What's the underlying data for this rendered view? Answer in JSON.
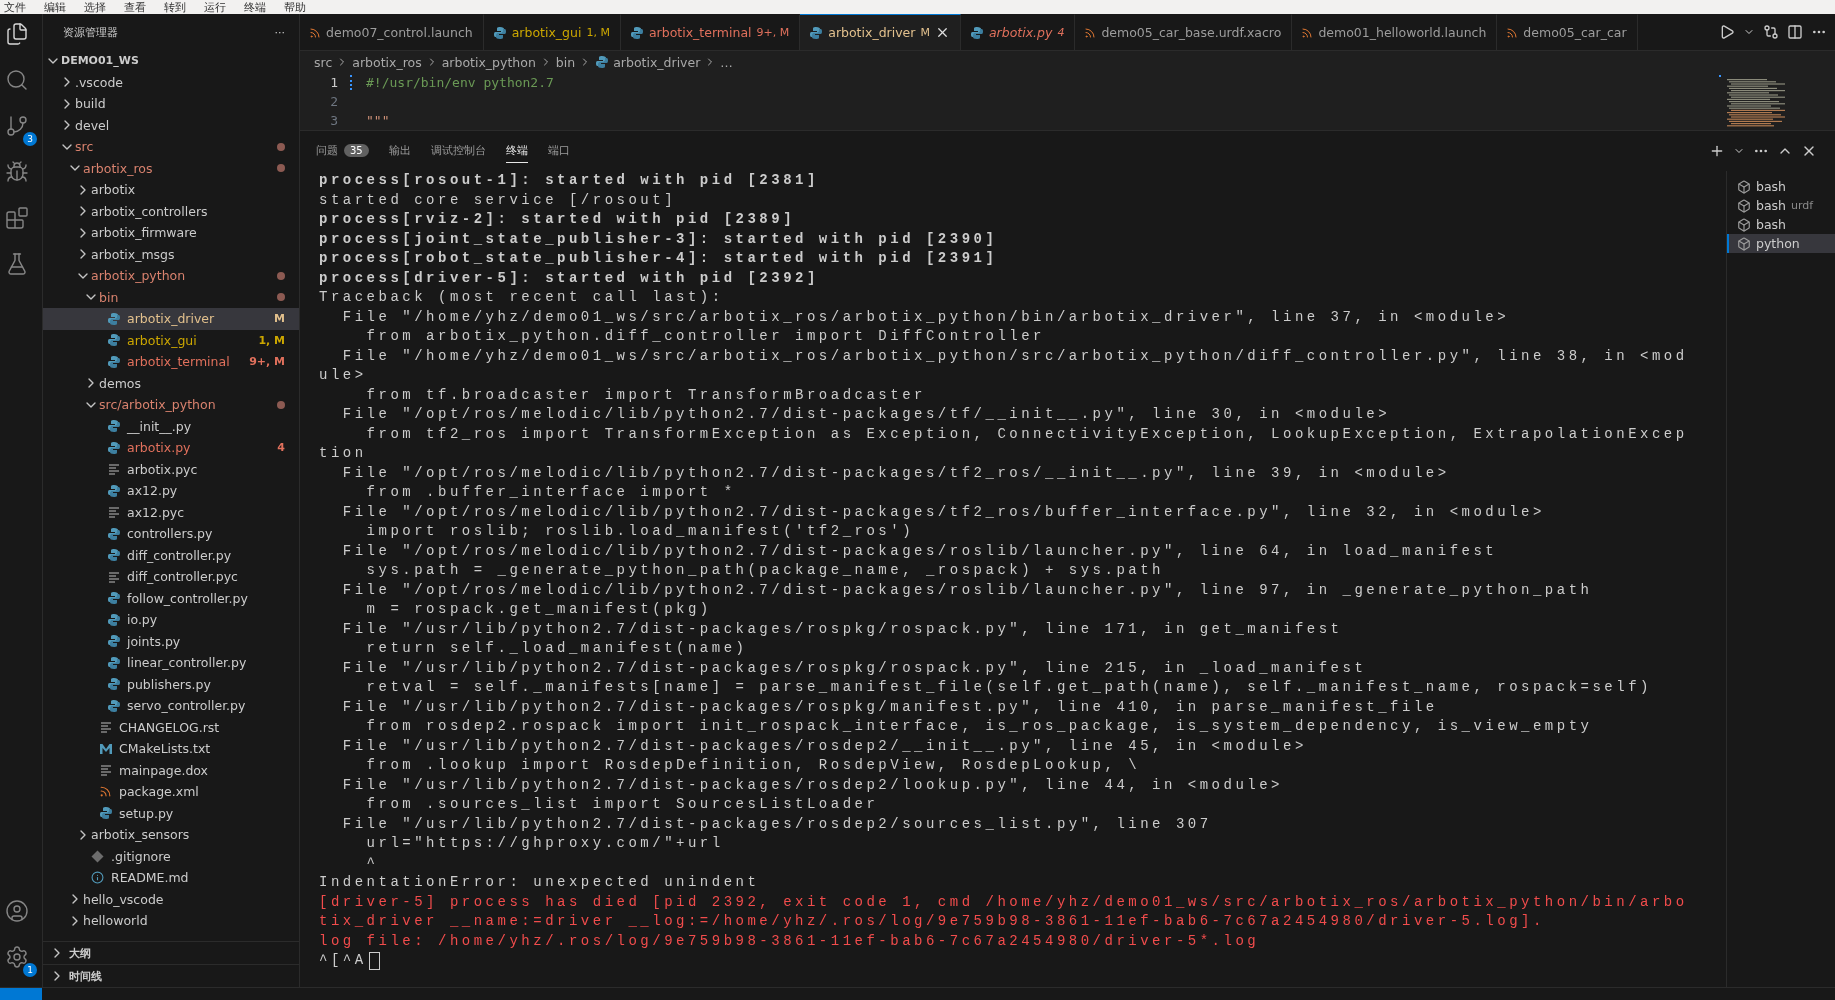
{
  "menu": [
    "文件",
    "编辑",
    "选择",
    "查看",
    "转到",
    "运行",
    "终端",
    "帮助"
  ],
  "activity_bar": {
    "top": [
      {
        "selected": true
      },
      {
        "selected": false
      },
      {
        "selected": false,
        "badge": "3"
      },
      {
        "selected": false
      },
      {
        "selected": false
      },
      {
        "selected": false
      }
    ],
    "bottom": [
      {
        "selected": false
      },
      {
        "selected": false,
        "badge": "1"
      }
    ]
  },
  "sidebar": {
    "title": "资源管理器",
    "more": "···",
    "workspace": {
      "label": "DEMO01_WS",
      "expanded": true
    },
    "tree": [
      {
        "label": ".vscode",
        "kind": "folder",
        "expanded": false,
        "modified": false,
        "selected": false
      },
      {
        "label": "build",
        "kind": "folder",
        "expanded": false,
        "modified": false,
        "selected": false
      },
      {
        "label": "devel",
        "kind": "folder",
        "expanded": false,
        "modified": false,
        "selected": false
      },
      {
        "label": "src",
        "kind": "folder",
        "expanded": true,
        "modified": true,
        "selected": false,
        "color": "#d9826e",
        "children": [
          {
            "label": "arbotix_ros",
            "kind": "folder",
            "expanded": true,
            "modified": true,
            "selected": false,
            "color": "#d9826e",
            "children": [
              {
                "label": "arbotix",
                "kind": "folder",
                "expanded": false,
                "modified": false,
                "selected": false
              },
              {
                "label": "arbotix_controllers",
                "kind": "folder",
                "expanded": false,
                "modified": false,
                "selected": false
              },
              {
                "label": "arbotix_firmware",
                "kind": "folder",
                "expanded": false,
                "modified": false,
                "selected": false
              },
              {
                "label": "arbotix_msgs",
                "kind": "folder",
                "expanded": false,
                "modified": false,
                "selected": false
              },
              {
                "label": "arbotix_python",
                "kind": "folder",
                "expanded": true,
                "modified": true,
                "selected": false,
                "color": "#d9826e",
                "children": [
                  {
                    "label": "bin",
                    "kind": "folder",
                    "expanded": true,
                    "modified": true,
                    "selected": false,
                    "color": "#d9826e",
                    "children": [
                      {
                        "label": "arbotix_driver",
                        "kind": "python",
                        "selected": true,
                        "color": "#e2c08d",
                        "badge": "M"
                      },
                      {
                        "label": "arbotix_gui",
                        "kind": "python",
                        "selected": false,
                        "color": "#cca700",
                        "badge": "1, M"
                      },
                      {
                        "label": "arbotix_terminal",
                        "kind": "python",
                        "selected": false,
                        "color": "#e0705c",
                        "badge": "9+, M"
                      }
                    ]
                  },
                  {
                    "label": "demos",
                    "kind": "folder",
                    "expanded": false,
                    "modified": false,
                    "selected": false
                  },
                  {
                    "label": "src/arbotix_python",
                    "kind": "folder",
                    "expanded": true,
                    "modified": true,
                    "selected": false,
                    "color": "#d9826e",
                    "children": [
                      {
                        "label": "__init__.py",
                        "kind": "python",
                        "selected": false
                      },
                      {
                        "label": "arbotix.py",
                        "kind": "python",
                        "selected": false,
                        "color": "#e0705c",
                        "badge": "4"
                      },
                      {
                        "label": "arbotix.pyc",
                        "kind": "text",
                        "selected": false
                      },
                      {
                        "label": "ax12.py",
                        "kind": "python",
                        "selected": false
                      },
                      {
                        "label": "ax12.pyc",
                        "kind": "text",
                        "selected": false
                      },
                      {
                        "label": "controllers.py",
                        "kind": "python",
                        "selected": false
                      },
                      {
                        "label": "diff_controller.py",
                        "kind": "python",
                        "selected": false
                      },
                      {
                        "label": "diff_controller.pyc",
                        "kind": "text",
                        "selected": false
                      },
                      {
                        "label": "follow_controller.py",
                        "kind": "python",
                        "selected": false
                      },
                      {
                        "label": "io.py",
                        "kind": "python",
                        "selected": false
                      },
                      {
                        "label": "joints.py",
                        "kind": "python",
                        "selected": false
                      },
                      {
                        "label": "linear_controller.py",
                        "kind": "python",
                        "selected": false
                      },
                      {
                        "label": "publishers.py",
                        "kind": "python",
                        "selected": false
                      },
                      {
                        "label": "servo_controller.py",
                        "kind": "python",
                        "selected": false
                      }
                    ]
                  },
                  {
                    "label": "CHANGELOG.rst",
                    "kind": "text",
                    "selected": false
                  },
                  {
                    "label": "CMakeLists.txt",
                    "kind": "cmake",
                    "selected": false
                  },
                  {
                    "label": "mainpage.dox",
                    "kind": "text",
                    "selected": false
                  },
                  {
                    "label": "package.xml",
                    "kind": "xml",
                    "selected": false
                  },
                  {
                    "label": "setup.py",
                    "kind": "python",
                    "selected": false
                  }
                ]
              },
              {
                "label": "arbotix_sensors",
                "kind": "folder",
                "expanded": false,
                "modified": false,
                "selected": false
              },
              {
                "label": ".gitignore",
                "kind": "git",
                "selected": false
              },
              {
                "label": "README.md",
                "kind": "info",
                "selected": false
              }
            ]
          },
          {
            "label": "hello_vscode",
            "kind": "folder",
            "expanded": false,
            "modified": false,
            "selected": false
          },
          {
            "label": "helloworld",
            "kind": "folder",
            "expanded": false,
            "modified": false,
            "selected": false
          }
        ]
      }
    ],
    "sections": [
      {
        "label": "大纲",
        "expanded": false
      },
      {
        "label": "时间线",
        "expanded": false
      }
    ]
  },
  "tabs": [
    {
      "label": "demo07_control.launch",
      "kind": "xml",
      "selected": false,
      "italic": false
    },
    {
      "label": "arbotix_gui",
      "kind": "python",
      "badge": "1, M",
      "color": "#cca700",
      "selected": false,
      "italic": false
    },
    {
      "label": "arbotix_terminal",
      "kind": "python",
      "badge": "9+, M",
      "color": "#e0705c",
      "selected": false,
      "italic": false
    },
    {
      "label": "arbotix_driver",
      "kind": "python",
      "badge": "M",
      "color": "#e2c08d",
      "selected": true,
      "italic": false
    },
    {
      "label": "arbotix.py",
      "kind": "python",
      "badge": "4",
      "color": "#e0705c",
      "selected": false,
      "italic": true
    },
    {
      "label": "demo05_car_base.urdf.xacro",
      "kind": "xml",
      "selected": false,
      "italic": false
    },
    {
      "label": "demo01_helloworld.launch",
      "kind": "xml",
      "selected": false,
      "italic": false
    },
    {
      "label": "demo05_car_car",
      "kind": "xml",
      "selected": false,
      "italic": false
    }
  ],
  "breadcrumb": [
    "src",
    "arbotix_ros",
    "arbotix_python",
    "bin",
    "arbotix_driver",
    "…"
  ],
  "editor": {
    "lines": [
      {
        "number": "1",
        "text": "#!/usr/bin/env python2.7",
        "kind": "comment"
      },
      {
        "number": "2",
        "kind": "blank"
      },
      {
        "number": "3",
        "text": "\"\"\"",
        "kind": "string"
      }
    ]
  },
  "panel": {
    "tabs": [
      {
        "label": "问题",
        "badge": "35",
        "selected": false
      },
      {
        "label": "输出",
        "selected": false
      },
      {
        "label": "调试控制台",
        "selected": false
      },
      {
        "label": "终端",
        "selected": true
      },
      {
        "label": "端口",
        "selected": false
      }
    ],
    "terminal_lines": [
      {
        "text": "process[rosout-1]: started with pid [2381]",
        "kind": "bold"
      },
      {
        "text": "started core service [/rosout]",
        "kind": "plain"
      },
      {
        "text": "process[rviz-2]: started with pid [2389]",
        "kind": "bold"
      },
      {
        "text": "process[joint_state_publisher-3]: started with pid [2390]",
        "kind": "bold"
      },
      {
        "text": "process[robot_state_publisher-4]: started with pid [2391]",
        "kind": "bold"
      },
      {
        "text": "process[driver-5]: started with pid [2392]",
        "kind": "bold"
      },
      {
        "text": "Traceback (most recent call last):",
        "kind": "plain"
      },
      {
        "text": "  File \"/home/yhz/demo01_ws/src/arbotix_ros/arbotix_python/bin/arbotix_driver\", line 37, in <module>",
        "kind": "plain"
      },
      {
        "text": "    from arbotix_python.diff_controller import DiffController",
        "kind": "plain"
      },
      {
        "text": "  File \"/home/yhz/demo01_ws/src/arbotix_ros/arbotix_python/src/arbotix_python/diff_controller.py\", line 38, in <mod",
        "kind": "plain"
      },
      {
        "text": "ule>",
        "kind": "plain"
      },
      {
        "text": "    from tf.broadcaster import TransformBroadcaster",
        "kind": "plain"
      },
      {
        "text": "  File \"/opt/ros/melodic/lib/python2.7/dist-packages/tf/__init__.py\", line 30, in <module>",
        "kind": "plain"
      },
      {
        "text": "    from tf2_ros import TransformException as Exception, ConnectivityException, LookupException, ExtrapolationExcep",
        "kind": "plain"
      },
      {
        "text": "tion",
        "kind": "plain"
      },
      {
        "text": "  File \"/opt/ros/melodic/lib/python2.7/dist-packages/tf2_ros/__init__.py\", line 39, in <module>",
        "kind": "plain"
      },
      {
        "text": "    from .buffer_interface import *",
        "kind": "plain"
      },
      {
        "text": "  File \"/opt/ros/melodic/lib/python2.7/dist-packages/tf2_ros/buffer_interface.py\", line 32, in <module>",
        "kind": "plain"
      },
      {
        "text": "    import roslib; roslib.load_manifest('tf2_ros')",
        "kind": "plain"
      },
      {
        "text": "  File \"/opt/ros/melodic/lib/python2.7/dist-packages/roslib/launcher.py\", line 64, in load_manifest",
        "kind": "plain"
      },
      {
        "text": "    sys.path = _generate_python_path(package_name, _rospack) + sys.path",
        "kind": "plain"
      },
      {
        "text": "  File \"/opt/ros/melodic/lib/python2.7/dist-packages/roslib/launcher.py\", line 97, in _generate_python_path",
        "kind": "plain"
      },
      {
        "text": "    m = rospack.get_manifest(pkg)",
        "kind": "plain"
      },
      {
        "text": "  File \"/usr/lib/python2.7/dist-packages/rospkg/rospack.py\", line 171, in get_manifest",
        "kind": "plain"
      },
      {
        "text": "    return self._load_manifest(name)",
        "kind": "plain"
      },
      {
        "text": "  File \"/usr/lib/python2.7/dist-packages/rospkg/rospack.py\", line 215, in _load_manifest",
        "kind": "plain"
      },
      {
        "text": "    retval = self._manifests[name] = parse_manifest_file(self.get_path(name), self._manifest_name, rospack=self)",
        "kind": "plain"
      },
      {
        "text": "  File \"/usr/lib/python2.7/dist-packages/rospkg/manifest.py\", line 410, in parse_manifest_file",
        "kind": "plain"
      },
      {
        "text": "    from rosdep2.rospack import init_rospack_interface, is_ros_package, is_system_dependency, is_view_empty",
        "kind": "plain"
      },
      {
        "text": "  File \"/usr/lib/python2.7/dist-packages/rosdep2/__init__.py\", line 45, in <module>",
        "kind": "plain"
      },
      {
        "text": "    from .lookup import RosdepDefinition, RosdepView, RosdepLookup, \\",
        "kind": "plain"
      },
      {
        "text": "  File \"/usr/lib/python2.7/dist-packages/rosdep2/lookup.py\", line 44, in <module>",
        "kind": "plain"
      },
      {
        "text": "    from .sources_list import SourcesListLoader",
        "kind": "plain"
      },
      {
        "text": "  File \"/usr/lib/python2.7/dist-packages/rosdep2/sources_list.py\", line 307",
        "kind": "plain"
      },
      {
        "text": "    url=\"https://ghproxy.com/\"+url",
        "kind": "plain"
      },
      {
        "text": "    ^",
        "kind": "plain"
      },
      {
        "text": "IndentationError: unexpected unindent",
        "kind": "plain"
      },
      {
        "text": "[driver-5] process has died [pid 2392, exit code 1, cmd /home/yhz/demo01_ws/src/arbotix_ros/arbotix_python/bin/arbo",
        "kind": "error"
      },
      {
        "text": "tix_driver __name:=driver __log:=/home/yhz/.ros/log/9e759b98-3861-11ef-bab6-7c67a2454980/driver-5.log].",
        "kind": "error"
      },
      {
        "text": "log file: /home/yhz/.ros/log/9e759b98-3861-11ef-bab6-7c67a2454980/driver-5*.log",
        "kind": "error"
      },
      {
        "text": "^[^A",
        "kind": "prompt"
      }
    ],
    "terminals": [
      {
        "label": "bash",
        "selected": false
      },
      {
        "label": "bash",
        "detail": "urdf",
        "selected": false
      },
      {
        "label": "bash",
        "selected": false
      },
      {
        "label": "python",
        "selected": true
      }
    ]
  }
}
